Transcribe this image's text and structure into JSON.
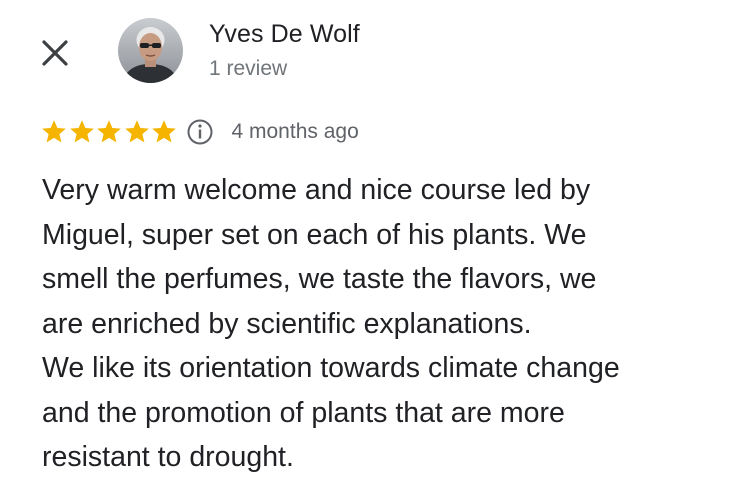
{
  "header": {
    "close_icon": "close-icon",
    "avatar_icon": "avatar",
    "reviewer_name": "Yves De Wolf",
    "review_count": "1 review"
  },
  "rating": {
    "stars": 5,
    "max_stars": 5,
    "star_color": "#f4b400",
    "info_icon": "info-icon",
    "date": "4 months ago"
  },
  "review": {
    "lines": [
      "Very warm welcome and nice course led by",
      "Miguel, super set on each of his plants. We",
      "smell the perfumes, we taste the flavors, we",
      "are enriched by scientific explanations.",
      "We like its orientation towards climate change",
      "and the promotion of plants that are more",
      "resistant to drought."
    ]
  },
  "colors": {
    "text_primary": "#202124",
    "text_secondary": "#70757a",
    "background": "#ffffff"
  }
}
